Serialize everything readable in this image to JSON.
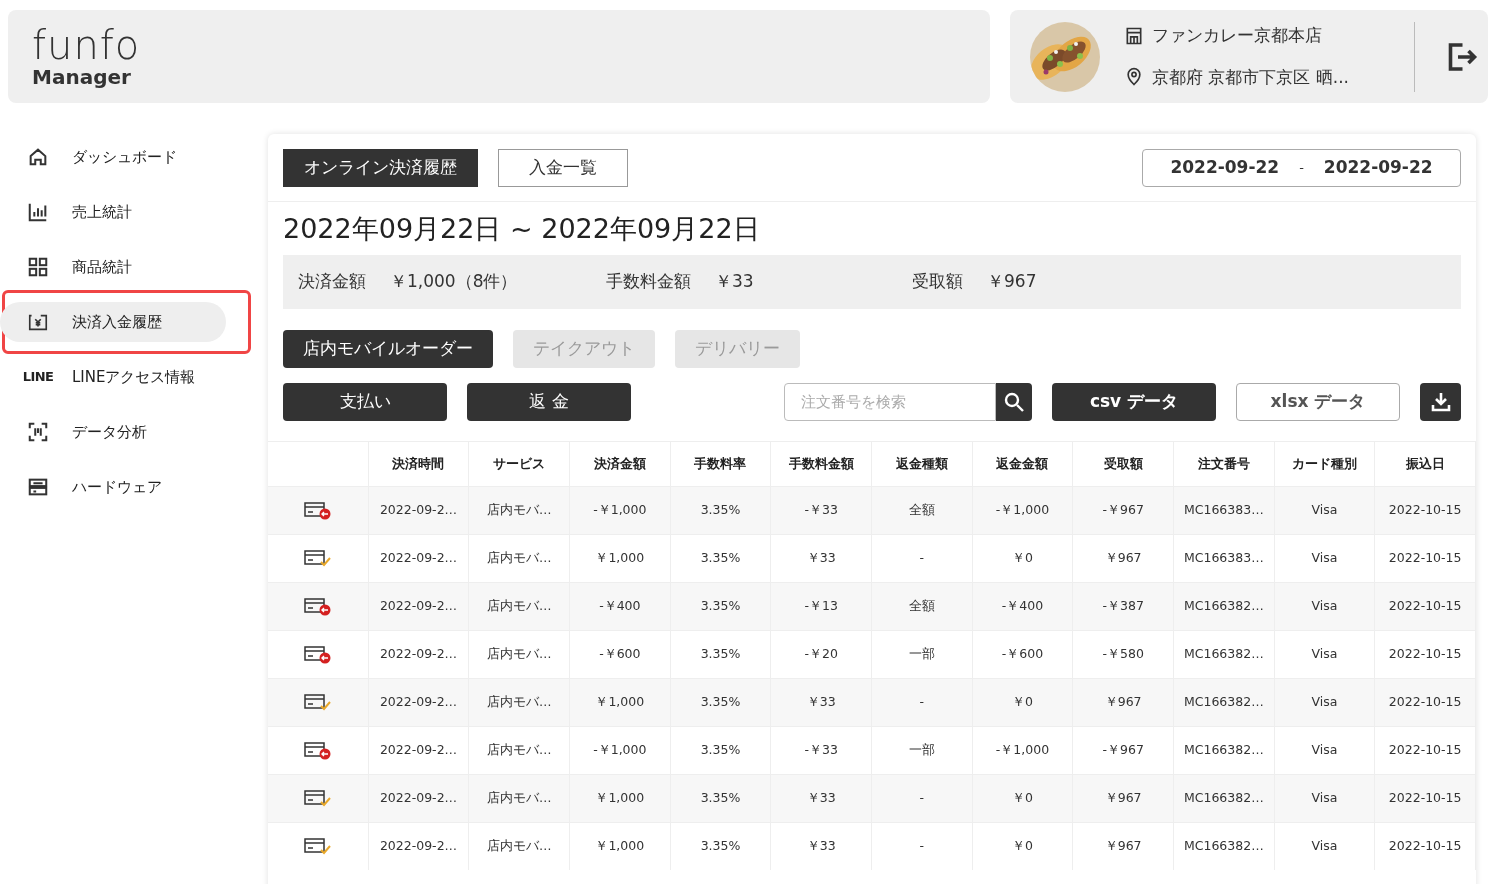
{
  "logo": {
    "brand": "funfo",
    "product": "Manager"
  },
  "shop": {
    "name": "ファンカレー京都本店",
    "address": "京都府 京都市下京区 晒..."
  },
  "sidebar": {
    "items": [
      {
        "label": "ダッシュボード",
        "selected": false
      },
      {
        "label": "売上統計",
        "selected": false
      },
      {
        "label": "商品統計",
        "selected": false
      },
      {
        "label": "決済入金履歴",
        "selected": true
      },
      {
        "label": "LINEアクセス情報",
        "icon_text": "LINE",
        "selected": false
      },
      {
        "label": "データ分析",
        "selected": false
      },
      {
        "label": "ハードウェア",
        "selected": false
      }
    ]
  },
  "tabs": [
    {
      "label": "オンライン決済履歴",
      "selected": true
    },
    {
      "label": "入金一覧",
      "selected": false
    }
  ],
  "date_range": {
    "start": "2022-09-22",
    "separator": "-",
    "end": "2022-09-22"
  },
  "title": "2022年09月22日 ~ 2022年09月22日",
  "summary": [
    {
      "label": "決済金額",
      "value": "￥1,000（8件）"
    },
    {
      "label": "手数料金額",
      "value": "￥33"
    },
    {
      "label": "受取額",
      "value": "￥967"
    }
  ],
  "service_filters": [
    {
      "label": "店内モバイルオーダー",
      "selected": true
    },
    {
      "label": "テイクアウト",
      "selected": false
    },
    {
      "label": "デリバリー",
      "selected": false
    }
  ],
  "type_buttons": [
    "支払い",
    "返 金"
  ],
  "search": {
    "placeholder": "注文番号を検索"
  },
  "export_buttons": [
    {
      "label": "csv データ",
      "kind": "filled"
    },
    {
      "label": "xlsx データ",
      "kind": "outline"
    }
  ],
  "table": {
    "columns": [
      "決済時間",
      "サービス",
      "決済金額",
      "手数料率",
      "手数料金額",
      "返金種類",
      "返金金額",
      "受取額",
      "注文番号",
      "カード種別",
      "振込日"
    ],
    "rows": [
      {
        "kind": "refund",
        "cells": [
          "2022-09-2…",
          "店内モバ…",
          "-￥1,000",
          "3.35%",
          "-￥33",
          "全額",
          "-￥1,000",
          "-￥967",
          "MC166383…",
          "Visa",
          "2022-10-15"
        ]
      },
      {
        "kind": "payment",
        "cells": [
          "2022-09-2…",
          "店内モバ…",
          "￥1,000",
          "3.35%",
          "￥33",
          "-",
          "￥0",
          "￥967",
          "MC166383…",
          "Visa",
          "2022-10-15"
        ]
      },
      {
        "kind": "refund",
        "cells": [
          "2022-09-2…",
          "店内モバ…",
          "-￥400",
          "3.35%",
          "-￥13",
          "全額",
          "-￥400",
          "-￥387",
          "MC166382…",
          "Visa",
          "2022-10-15"
        ]
      },
      {
        "kind": "refund",
        "cells": [
          "2022-09-2…",
          "店内モバ…",
          "-￥600",
          "3.35%",
          "-￥20",
          "一部",
          "-￥600",
          "-￥580",
          "MC166382…",
          "Visa",
          "2022-10-15"
        ]
      },
      {
        "kind": "payment",
        "cells": [
          "2022-09-2…",
          "店内モバ…",
          "￥1,000",
          "3.35%",
          "￥33",
          "-",
          "￥0",
          "￥967",
          "MC166382…",
          "Visa",
          "2022-10-15"
        ]
      },
      {
        "kind": "refund",
        "cells": [
          "2022-09-2…",
          "店内モバ…",
          "-￥1,000",
          "3.35%",
          "-￥33",
          "一部",
          "-￥1,000",
          "-￥967",
          "MC166382…",
          "Visa",
          "2022-10-15"
        ]
      },
      {
        "kind": "payment",
        "cells": [
          "2022-09-2…",
          "店内モバ…",
          "￥1,000",
          "3.35%",
          "￥33",
          "-",
          "￥0",
          "￥967",
          "MC166382…",
          "Visa",
          "2022-10-15"
        ]
      },
      {
        "kind": "payment",
        "cells": [
          "2022-09-2…",
          "店内モバ…",
          "￥1,000",
          "3.35%",
          "￥33",
          "-",
          "￥0",
          "￥967",
          "MC166382…",
          "Visa",
          "2022-10-15"
        ]
      }
    ]
  }
}
